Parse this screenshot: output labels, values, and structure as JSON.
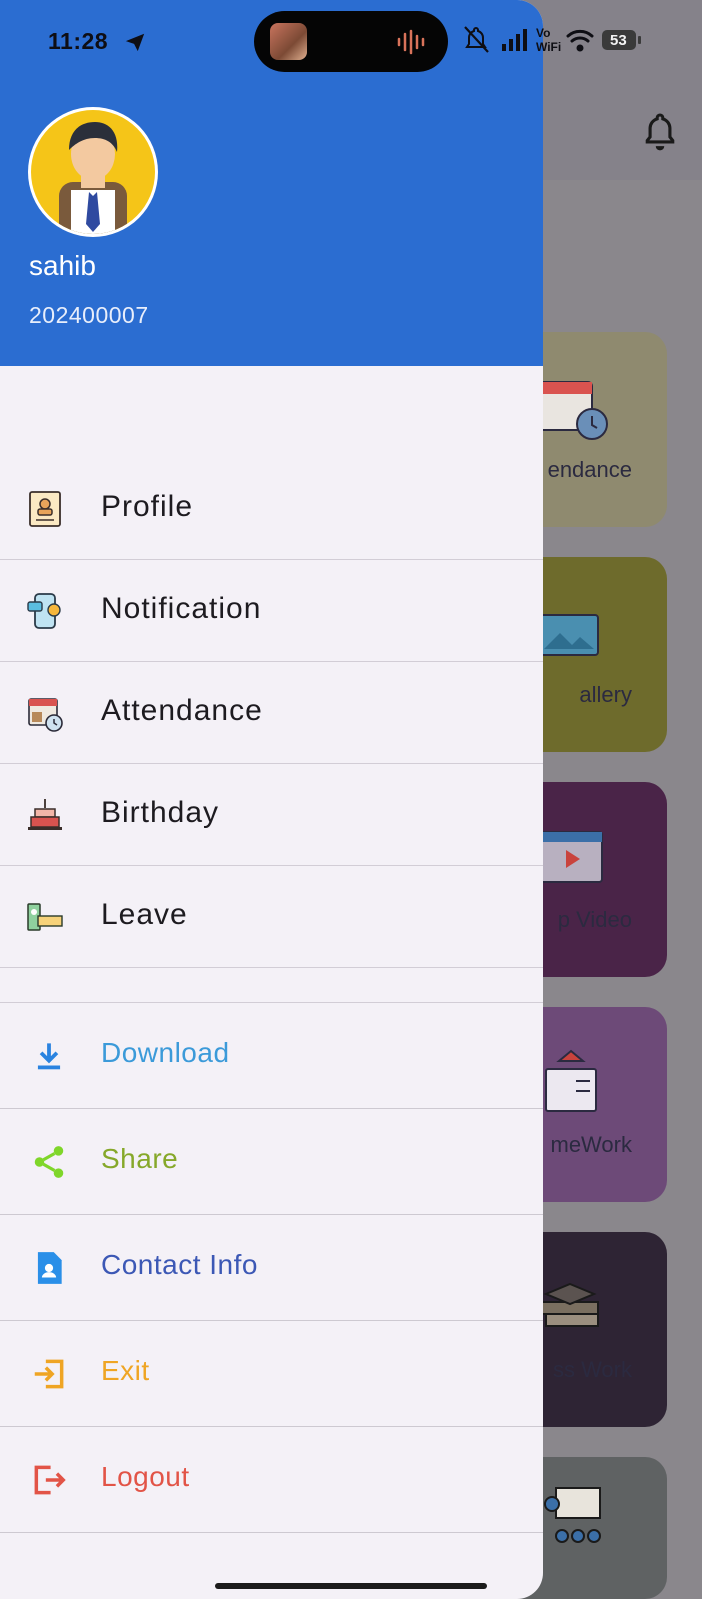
{
  "status_bar": {
    "time": "11:28",
    "battery": "53",
    "network": "Vo WiFi"
  },
  "drawer": {
    "user": {
      "name": "sahib",
      "id": "202400007"
    },
    "menu": [
      {
        "label": "Profile",
        "icon": "profile-card-icon"
      },
      {
        "label": "Notification",
        "icon": "phone-notification-icon"
      },
      {
        "label": "Attendance",
        "icon": "calendar-clock-icon"
      },
      {
        "label": "Birthday",
        "icon": "birthday-cake-icon"
      },
      {
        "label": "Leave",
        "icon": "leave-ticket-icon"
      }
    ],
    "actions": [
      {
        "label": "Download",
        "icon": "download-icon",
        "color": "#3b9ad9"
      },
      {
        "label": "Share",
        "icon": "share-icon",
        "color": "#86a82a"
      },
      {
        "label": "Contact Info",
        "icon": "contact-document-icon",
        "color": "#3c58b5"
      },
      {
        "label": "Exit",
        "icon": "exit-icon",
        "color": "#efa524"
      },
      {
        "label": "Logout",
        "icon": "logout-icon",
        "color": "#e25447"
      }
    ]
  },
  "background": {
    "tiles": [
      {
        "label": "endance",
        "color": "#8f8a6f"
      },
      {
        "label": "allery",
        "color": "#6e6b2c"
      },
      {
        "label": "p Video",
        "color": "#4a2448"
      },
      {
        "label": "meWork",
        "color": "#6d4a78"
      },
      {
        "label": "ss Work",
        "color": "#2e2434"
      },
      {
        "label": "",
        "color": "#5f6263"
      }
    ]
  },
  "colors": {
    "header": "#2b6dd1",
    "drawer_bg": "#f4f1f7"
  }
}
